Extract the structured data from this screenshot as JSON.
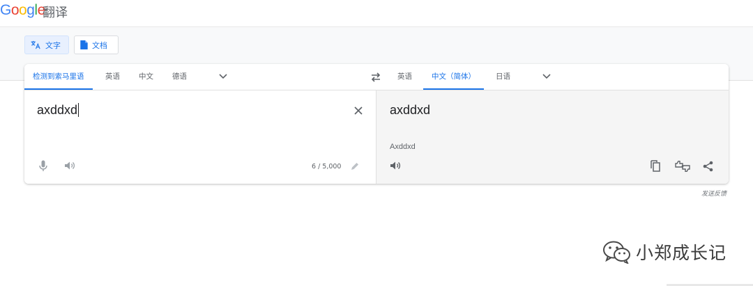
{
  "header": {
    "logo_letters": [
      "G",
      "o",
      "o",
      "g",
      "l",
      "e"
    ],
    "product": "翻译"
  },
  "modes": [
    {
      "label": "文字",
      "icon": "translate-icon",
      "active": true
    },
    {
      "label": "文档",
      "icon": "document-icon",
      "active": false
    }
  ],
  "source_langs": [
    "检测到索马里语",
    "英语",
    "中文",
    "德语"
  ],
  "source_active": 0,
  "target_langs": [
    "英语",
    "中文（简体）",
    "日语"
  ],
  "target_active": 1,
  "source": {
    "text": "axddxd",
    "counter": "6 / 5,000"
  },
  "target": {
    "text": "axddxd",
    "transliteration": "Axddxd"
  },
  "feedback": "发送反馈",
  "watermark": {
    "text": "小郑成长记",
    "icon": "wechat-icon"
  },
  "colors": {
    "accent": "#1a73e8",
    "icon_gray": "#5f6368",
    "target_bg": "#f5f5f5"
  }
}
